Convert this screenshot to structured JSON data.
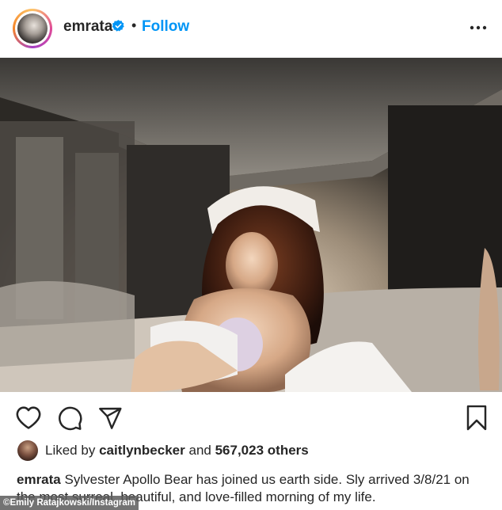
{
  "header": {
    "username": "emrata",
    "separator": "•",
    "follow_label": "Follow"
  },
  "icons": {
    "avatar": "profile-avatar",
    "verified": "verified-badge-icon",
    "more": "more-options-icon",
    "like": "heart-icon",
    "comment": "comment-icon",
    "share": "send-icon",
    "save": "bookmark-icon"
  },
  "colors": {
    "accent": "#0095f6",
    "text": "#262626"
  },
  "likes": {
    "prefix": "Liked by",
    "user": "caitlynbecker",
    "middle": "and",
    "count": "567,023 others"
  },
  "caption": {
    "user": "emrata",
    "text": "Sylvester Apollo Bear has joined us earth side. Sly arrived 3/8/21 on the most surreal, beautiful, and love-filled morning of my life."
  },
  "credit": "©Emily Ratajkowski/Instagram"
}
